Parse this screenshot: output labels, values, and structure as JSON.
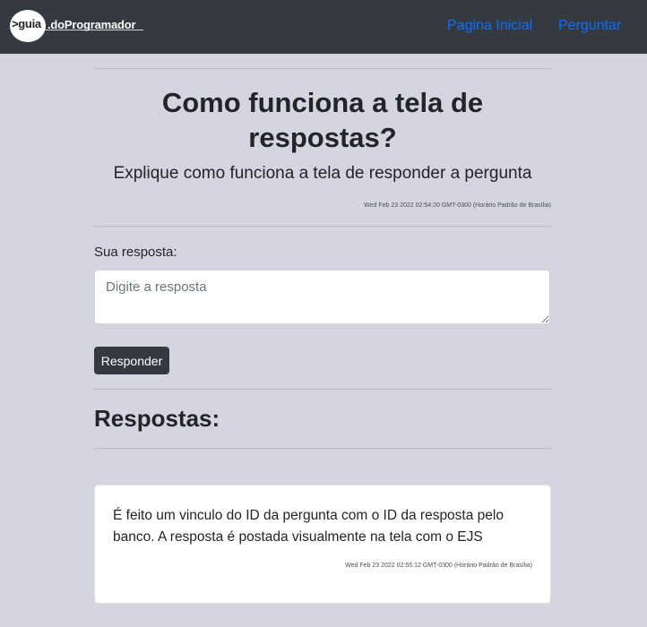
{
  "navbar": {
    "logo_part1": ">guia",
    "logo_part2": ".doProgramador",
    "links": [
      "Pagina Inicial",
      "Perguntar"
    ],
    "link_color": "#0d6efd",
    "background": "#343a40"
  },
  "question": {
    "title": "Como funciona a tela de respostas?",
    "description": "Explique como funciona a tela de responder a pergunta",
    "date": "Wed Feb 23 2022 02:54:20 GMT-0300 (Horário Padrão de Brasília)"
  },
  "answer_form": {
    "label": "Sua resposta:",
    "placeholder": "Digite a resposta",
    "value": "",
    "submit_label": "Responder"
  },
  "answers": {
    "heading": "Respostas:",
    "items": [
      {
        "text": "É feito um vinculo do ID da pergunta com o ID da resposta pelo banco. A resposta é postada visualmente na tela com o EJS",
        "date": "Wed Feb 23 2022 02:55:12 GMT-0300 (Horário Padrão de Brasília)"
      }
    ]
  },
  "colors": {
    "page_background": "#d5d4e1",
    "button": "#343a40"
  }
}
